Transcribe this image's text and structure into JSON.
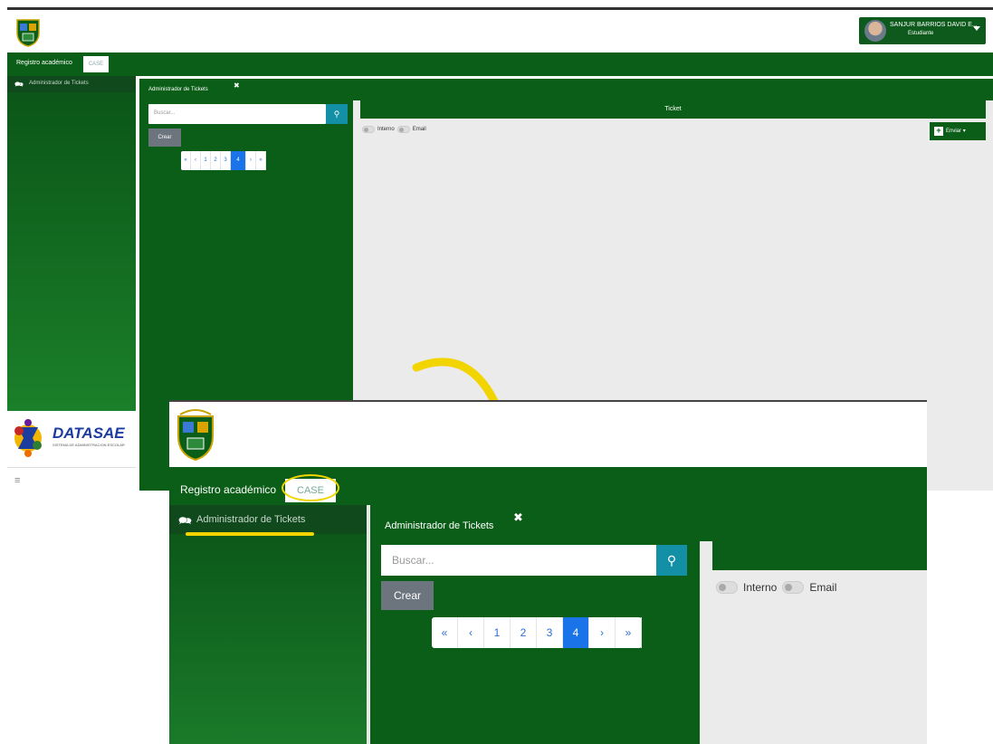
{
  "header": {
    "user_name": "SANJUR BARRIOS DAVID E...",
    "user_role": "Estudiante"
  },
  "tabs": {
    "registro_label": "Registro académico",
    "case_label": "CASE"
  },
  "sidebar": {
    "items": [
      {
        "label": "Administrador de Tickets",
        "icon": "chat-icon"
      }
    ],
    "brand": "DATASAE",
    "brand_sub": "SISTEMA DE ADMINISTRACION ESCOLAR"
  },
  "panel": {
    "title": "Administrador de Tickets",
    "close_glyph": "✖"
  },
  "search": {
    "placeholder": "Buscar...",
    "button_icon": "search-icon"
  },
  "crear_label": "Crear",
  "pagination": {
    "first": "«",
    "prev": "‹",
    "pages": [
      "1",
      "2",
      "3",
      "4"
    ],
    "active": "4",
    "next": "›",
    "last": "»"
  },
  "ticket": {
    "title": "Ticket",
    "toggle_interno": "Interno",
    "toggle_email": "Email",
    "enviar_label": "Enviar"
  },
  "colors": {
    "brand_green": "#0b5e18",
    "accent_blue": "#1a73e8",
    "search_button": "#138fa6",
    "highlight_yellow": "#f2d400"
  }
}
